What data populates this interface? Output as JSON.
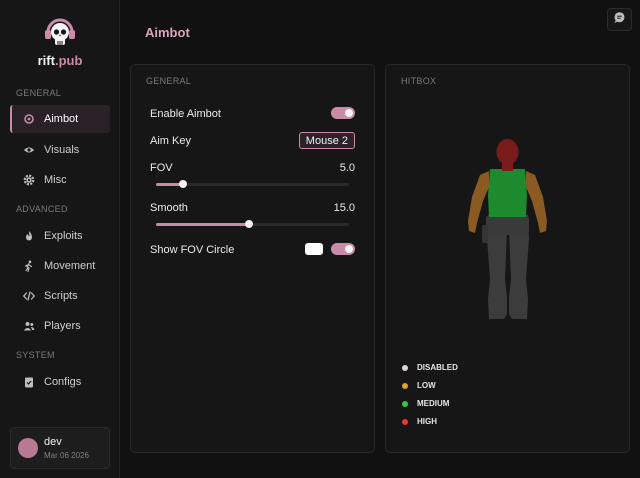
{
  "brand": {
    "name": "rift",
    "suffix": ".pub"
  },
  "sidebar": {
    "sections": [
      {
        "label": "GENERAL"
      },
      {
        "label": "ADVANCED"
      },
      {
        "label": "SYSTEM"
      }
    ],
    "items": [
      {
        "label": "Aimbot",
        "icon": "crosshair-icon",
        "active": true
      },
      {
        "label": "Visuals",
        "icon": "eye-icon"
      },
      {
        "label": "Misc",
        "icon": "gear-icon"
      },
      {
        "label": "Exploits",
        "icon": "flame-icon"
      },
      {
        "label": "Movement",
        "icon": "running-icon"
      },
      {
        "label": "Scripts",
        "icon": "code-icon"
      },
      {
        "label": "Players",
        "icon": "users-icon"
      },
      {
        "label": "Configs",
        "icon": "clipboard-icon"
      }
    ]
  },
  "user": {
    "name": "dev",
    "date": "Mar 06 2026"
  },
  "page": {
    "title": "Aimbot"
  },
  "general_panel": {
    "title": "GENERAL",
    "enable_aimbot": {
      "label": "Enable Aimbot",
      "on": true
    },
    "aim_key": {
      "label": "Aim Key",
      "value": "Mouse 2"
    },
    "fov": {
      "label": "FOV",
      "value": "5.0",
      "fraction": 0.14
    },
    "smooth": {
      "label": "Smooth",
      "value": "15.0",
      "fraction": 0.48
    },
    "show_fov_circle": {
      "label": "Show FOV Circle",
      "on": true,
      "color": "#ffffff"
    }
  },
  "hitbox_panel": {
    "title": "HITBOX",
    "legend": [
      {
        "label": "DISABLED",
        "color": "#d9d9d9"
      },
      {
        "label": "LOW",
        "color": "#e2a030"
      },
      {
        "label": "MEDIUM",
        "color": "#2ecc40"
      },
      {
        "label": "HIGH",
        "color": "#e83a2e"
      }
    ],
    "regions": {
      "head": "HIGH",
      "torso": "MEDIUM",
      "arms": "LOW",
      "legs": "DISABLED"
    }
  },
  "colors": {
    "accent": "#c98ba8",
    "background": "#111111",
    "panel": "#161616"
  }
}
